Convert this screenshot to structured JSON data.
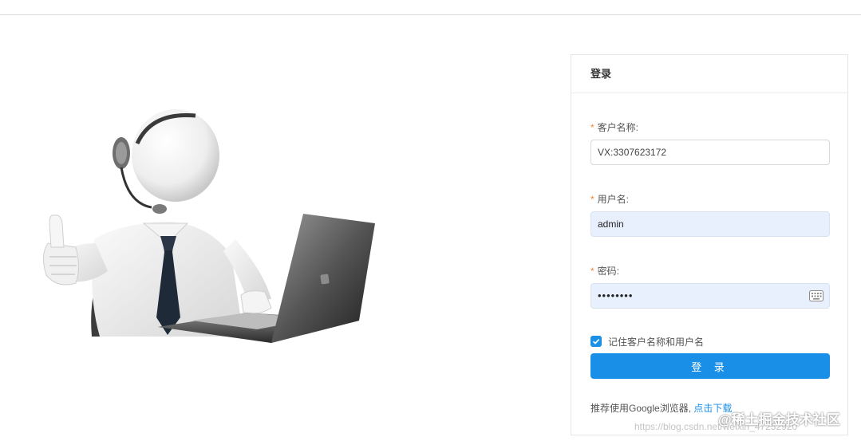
{
  "header": {
    "title": "登录"
  },
  "form": {
    "customer_name": {
      "label": "客户名称:",
      "value": "VX:3307623172"
    },
    "username": {
      "label": "用户名:",
      "value": "admin"
    },
    "password": {
      "label": "密码:",
      "value": "••••••••"
    },
    "required_mark": "*",
    "remember": {
      "label": "记住客户名称和用户名",
      "checked": true
    },
    "submit_label": "登 录"
  },
  "tip": {
    "text": "推荐使用Google浏览器,",
    "link_text": "点击下载"
  },
  "watermark": {
    "text": "@稀土掘金技术社区",
    "url_text": "https://blog.csdn.net/weixin_47252920"
  },
  "illustration": {
    "icon": "support-person-laptop-illustration"
  },
  "colors": {
    "accent": "#1a8fe8",
    "required": "#f0883a",
    "autofill_bg": "#e8f0fe"
  }
}
